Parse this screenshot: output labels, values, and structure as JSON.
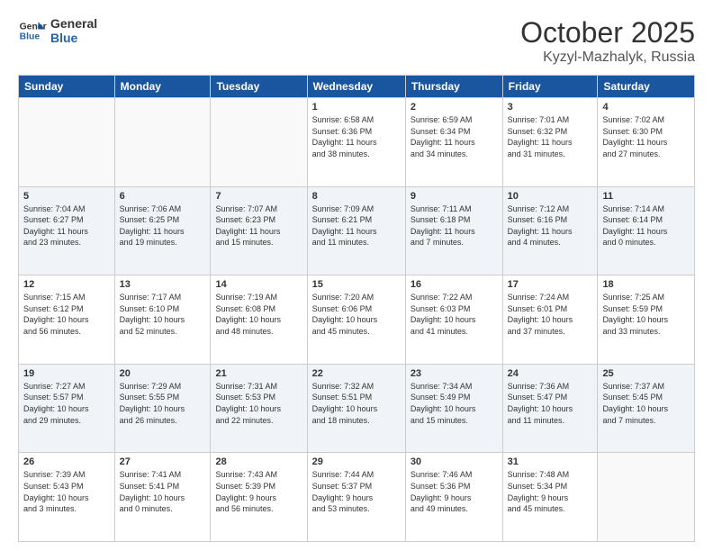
{
  "header": {
    "logo_general": "General",
    "logo_blue": "Blue",
    "month": "October 2025",
    "location": "Kyzyl-Mazhalyk, Russia"
  },
  "weekdays": [
    "Sunday",
    "Monday",
    "Tuesday",
    "Wednesday",
    "Thursday",
    "Friday",
    "Saturday"
  ],
  "weeks": [
    [
      {
        "day": "",
        "info": ""
      },
      {
        "day": "",
        "info": ""
      },
      {
        "day": "",
        "info": ""
      },
      {
        "day": "1",
        "info": "Sunrise: 6:58 AM\nSunset: 6:36 PM\nDaylight: 11 hours\nand 38 minutes."
      },
      {
        "day": "2",
        "info": "Sunrise: 6:59 AM\nSunset: 6:34 PM\nDaylight: 11 hours\nand 34 minutes."
      },
      {
        "day": "3",
        "info": "Sunrise: 7:01 AM\nSunset: 6:32 PM\nDaylight: 11 hours\nand 31 minutes."
      },
      {
        "day": "4",
        "info": "Sunrise: 7:02 AM\nSunset: 6:30 PM\nDaylight: 11 hours\nand 27 minutes."
      }
    ],
    [
      {
        "day": "5",
        "info": "Sunrise: 7:04 AM\nSunset: 6:27 PM\nDaylight: 11 hours\nand 23 minutes."
      },
      {
        "day": "6",
        "info": "Sunrise: 7:06 AM\nSunset: 6:25 PM\nDaylight: 11 hours\nand 19 minutes."
      },
      {
        "day": "7",
        "info": "Sunrise: 7:07 AM\nSunset: 6:23 PM\nDaylight: 11 hours\nand 15 minutes."
      },
      {
        "day": "8",
        "info": "Sunrise: 7:09 AM\nSunset: 6:21 PM\nDaylight: 11 hours\nand 11 minutes."
      },
      {
        "day": "9",
        "info": "Sunrise: 7:11 AM\nSunset: 6:18 PM\nDaylight: 11 hours\nand 7 minutes."
      },
      {
        "day": "10",
        "info": "Sunrise: 7:12 AM\nSunset: 6:16 PM\nDaylight: 11 hours\nand 4 minutes."
      },
      {
        "day": "11",
        "info": "Sunrise: 7:14 AM\nSunset: 6:14 PM\nDaylight: 11 hours\nand 0 minutes."
      }
    ],
    [
      {
        "day": "12",
        "info": "Sunrise: 7:15 AM\nSunset: 6:12 PM\nDaylight: 10 hours\nand 56 minutes."
      },
      {
        "day": "13",
        "info": "Sunrise: 7:17 AM\nSunset: 6:10 PM\nDaylight: 10 hours\nand 52 minutes."
      },
      {
        "day": "14",
        "info": "Sunrise: 7:19 AM\nSunset: 6:08 PM\nDaylight: 10 hours\nand 48 minutes."
      },
      {
        "day": "15",
        "info": "Sunrise: 7:20 AM\nSunset: 6:06 PM\nDaylight: 10 hours\nand 45 minutes."
      },
      {
        "day": "16",
        "info": "Sunrise: 7:22 AM\nSunset: 6:03 PM\nDaylight: 10 hours\nand 41 minutes."
      },
      {
        "day": "17",
        "info": "Sunrise: 7:24 AM\nSunset: 6:01 PM\nDaylight: 10 hours\nand 37 minutes."
      },
      {
        "day": "18",
        "info": "Sunrise: 7:25 AM\nSunset: 5:59 PM\nDaylight: 10 hours\nand 33 minutes."
      }
    ],
    [
      {
        "day": "19",
        "info": "Sunrise: 7:27 AM\nSunset: 5:57 PM\nDaylight: 10 hours\nand 29 minutes."
      },
      {
        "day": "20",
        "info": "Sunrise: 7:29 AM\nSunset: 5:55 PM\nDaylight: 10 hours\nand 26 minutes."
      },
      {
        "day": "21",
        "info": "Sunrise: 7:31 AM\nSunset: 5:53 PM\nDaylight: 10 hours\nand 22 minutes."
      },
      {
        "day": "22",
        "info": "Sunrise: 7:32 AM\nSunset: 5:51 PM\nDaylight: 10 hours\nand 18 minutes."
      },
      {
        "day": "23",
        "info": "Sunrise: 7:34 AM\nSunset: 5:49 PM\nDaylight: 10 hours\nand 15 minutes."
      },
      {
        "day": "24",
        "info": "Sunrise: 7:36 AM\nSunset: 5:47 PM\nDaylight: 10 hours\nand 11 minutes."
      },
      {
        "day": "25",
        "info": "Sunrise: 7:37 AM\nSunset: 5:45 PM\nDaylight: 10 hours\nand 7 minutes."
      }
    ],
    [
      {
        "day": "26",
        "info": "Sunrise: 7:39 AM\nSunset: 5:43 PM\nDaylight: 10 hours\nand 3 minutes."
      },
      {
        "day": "27",
        "info": "Sunrise: 7:41 AM\nSunset: 5:41 PM\nDaylight: 10 hours\nand 0 minutes."
      },
      {
        "day": "28",
        "info": "Sunrise: 7:43 AM\nSunset: 5:39 PM\nDaylight: 9 hours\nand 56 minutes."
      },
      {
        "day": "29",
        "info": "Sunrise: 7:44 AM\nSunset: 5:37 PM\nDaylight: 9 hours\nand 53 minutes."
      },
      {
        "day": "30",
        "info": "Sunrise: 7:46 AM\nSunset: 5:36 PM\nDaylight: 9 hours\nand 49 minutes."
      },
      {
        "day": "31",
        "info": "Sunrise: 7:48 AM\nSunset: 5:34 PM\nDaylight: 9 hours\nand 45 minutes."
      },
      {
        "day": "",
        "info": ""
      }
    ]
  ]
}
